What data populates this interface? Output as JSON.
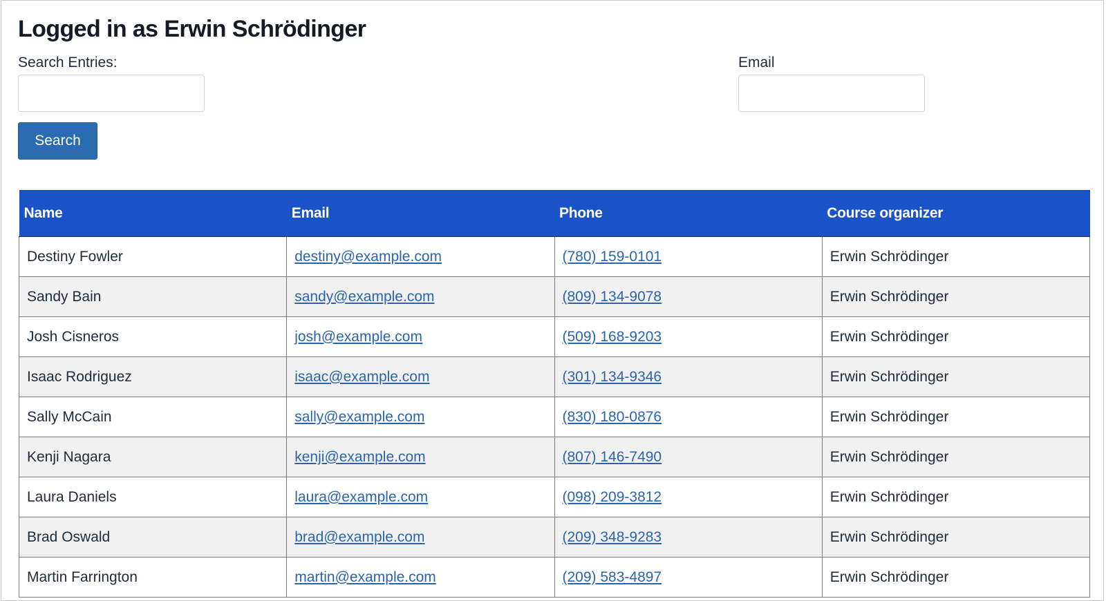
{
  "header": {
    "title": "Logged in as Erwin Schrödinger"
  },
  "search": {
    "label": "Search Entries:",
    "value": "",
    "placeholder": "",
    "button_label": "Search"
  },
  "email_filter": {
    "label": "Email",
    "value": "",
    "placeholder": ""
  },
  "colors": {
    "header_bg": "#1a52c8",
    "button_bg": "#2b6cb0",
    "link": "#2a64b0",
    "stripe": "#f1f1f1"
  },
  "table": {
    "columns": [
      "Name",
      "Email",
      "Phone",
      "Course organizer"
    ],
    "rows": [
      {
        "name": "Destiny Fowler",
        "email": "destiny@example.com",
        "phone": "(780) 159-0101",
        "organizer": "Erwin Schrödinger"
      },
      {
        "name": "Sandy Bain",
        "email": "sandy@example.com",
        "phone": "(809) 134-9078",
        "organizer": "Erwin Schrödinger"
      },
      {
        "name": "Josh Cisneros",
        "email": "josh@example.com",
        "phone": "(509) 168-9203",
        "organizer": "Erwin Schrödinger"
      },
      {
        "name": "Isaac Rodriguez",
        "email": "isaac@example.com",
        "phone": "(301) 134-9346",
        "organizer": "Erwin Schrödinger"
      },
      {
        "name": "Sally McCain",
        "email": "sally@example.com",
        "phone": "(830) 180-0876",
        "organizer": "Erwin Schrödinger"
      },
      {
        "name": "Kenji Nagara",
        "email": "kenji@example.com",
        "phone": "(807) 146-7490",
        "organizer": "Erwin Schrödinger"
      },
      {
        "name": "Laura Daniels",
        "email": "laura@example.com",
        "phone": "(098) 209-3812",
        "organizer": "Erwin Schrödinger"
      },
      {
        "name": "Brad Oswald",
        "email": "brad@example.com",
        "phone": "(209) 348-9283",
        "organizer": "Erwin Schrödinger"
      },
      {
        "name": "Martin Farrington",
        "email": "martin@example.com",
        "phone": "(209) 583-4897",
        "organizer": "Erwin Schrödinger"
      }
    ]
  }
}
